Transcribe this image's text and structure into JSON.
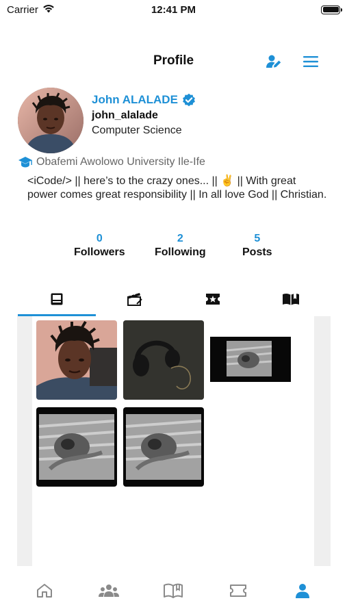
{
  "status_bar": {
    "carrier": "Carrier",
    "time": "12:41 PM"
  },
  "header": {
    "title": "Profile",
    "edit_icon": "user-edit-icon",
    "menu_icon": "hamburger-menu-icon"
  },
  "profile": {
    "full_name": "John ALALADE",
    "verified_icon": "verified-badge-icon",
    "username": "john_alalade",
    "department": "Computer Science",
    "school_icon": "graduation-cap-icon",
    "school": "Obafemi Awolowo University Ile-Ife",
    "bio": "<iCode/> || here’s to the crazy ones... || ✌️ || With great power comes great responsibility || In all love God || Christian."
  },
  "stats": [
    {
      "count": "0",
      "label": "Followers"
    },
    {
      "count": "2",
      "label": "Following"
    },
    {
      "count": "5",
      "label": "Posts"
    }
  ],
  "tabs": [
    {
      "icon": "posts-icon",
      "active": true
    },
    {
      "icon": "clapperboard-icon",
      "active": false
    },
    {
      "icon": "ticket-star-icon",
      "active": false
    },
    {
      "icon": "open-book-icon",
      "active": false
    }
  ],
  "bottom_nav": [
    {
      "icon": "home-icon",
      "active": false
    },
    {
      "icon": "community-icon",
      "active": false
    },
    {
      "icon": "book-icon",
      "active": false
    },
    {
      "icon": "ticket-icon",
      "active": false
    },
    {
      "icon": "profile-icon",
      "active": true
    }
  ],
  "colors": {
    "accent": "#1e90d6",
    "inactive_icon": "#8a8a8a"
  }
}
